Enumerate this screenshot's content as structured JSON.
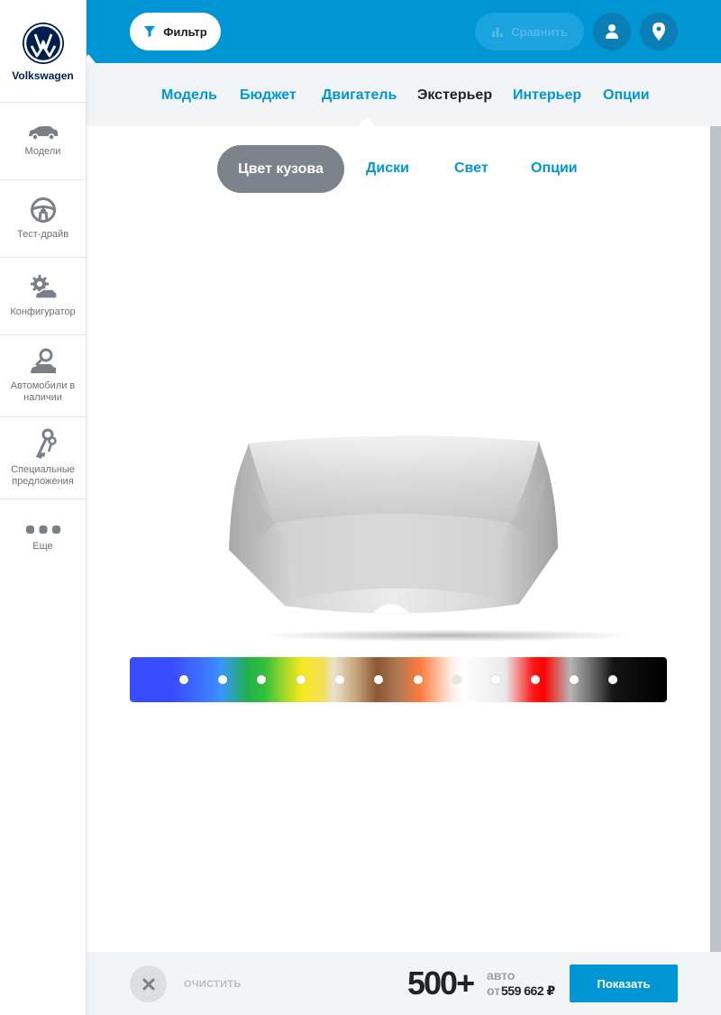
{
  "brand": {
    "name": "Volkswagen"
  },
  "sidebar": {
    "items": [
      {
        "label": "Модели",
        "icon": "car-icon"
      },
      {
        "label": "Тест-драйв",
        "icon": "steering-wheel-icon"
      },
      {
        "label": "Конфигуратор",
        "icon": "car-gear-icon"
      },
      {
        "label": "Автомобили в наличии",
        "icon": "car-search-icon"
      },
      {
        "label": "Специальные предложения",
        "icon": "keys-icon"
      },
      {
        "label": "Еще",
        "icon": "more-dots-icon"
      }
    ]
  },
  "topbar": {
    "filter_label": "Фильтр",
    "compare_label": "Сравнить"
  },
  "tabs": [
    "Модель",
    "Бюджет",
    "Двигатель",
    "Экстерьер",
    "Интерьер",
    "Опции"
  ],
  "active_tab": "Экстерьер",
  "subtabs": [
    "Цвет кузова",
    "Диски",
    "Свет",
    "Опции"
  ],
  "active_subtab": "Цвет кузова",
  "colors": {
    "accent": "#0096d6",
    "swatch_count": 12
  },
  "footer": {
    "clear_label": "ОЧИСТИТЬ",
    "count": "500+",
    "auto_label": "авто",
    "from_label": "от",
    "price": "559 662 ₽",
    "show_label": "Показать"
  }
}
